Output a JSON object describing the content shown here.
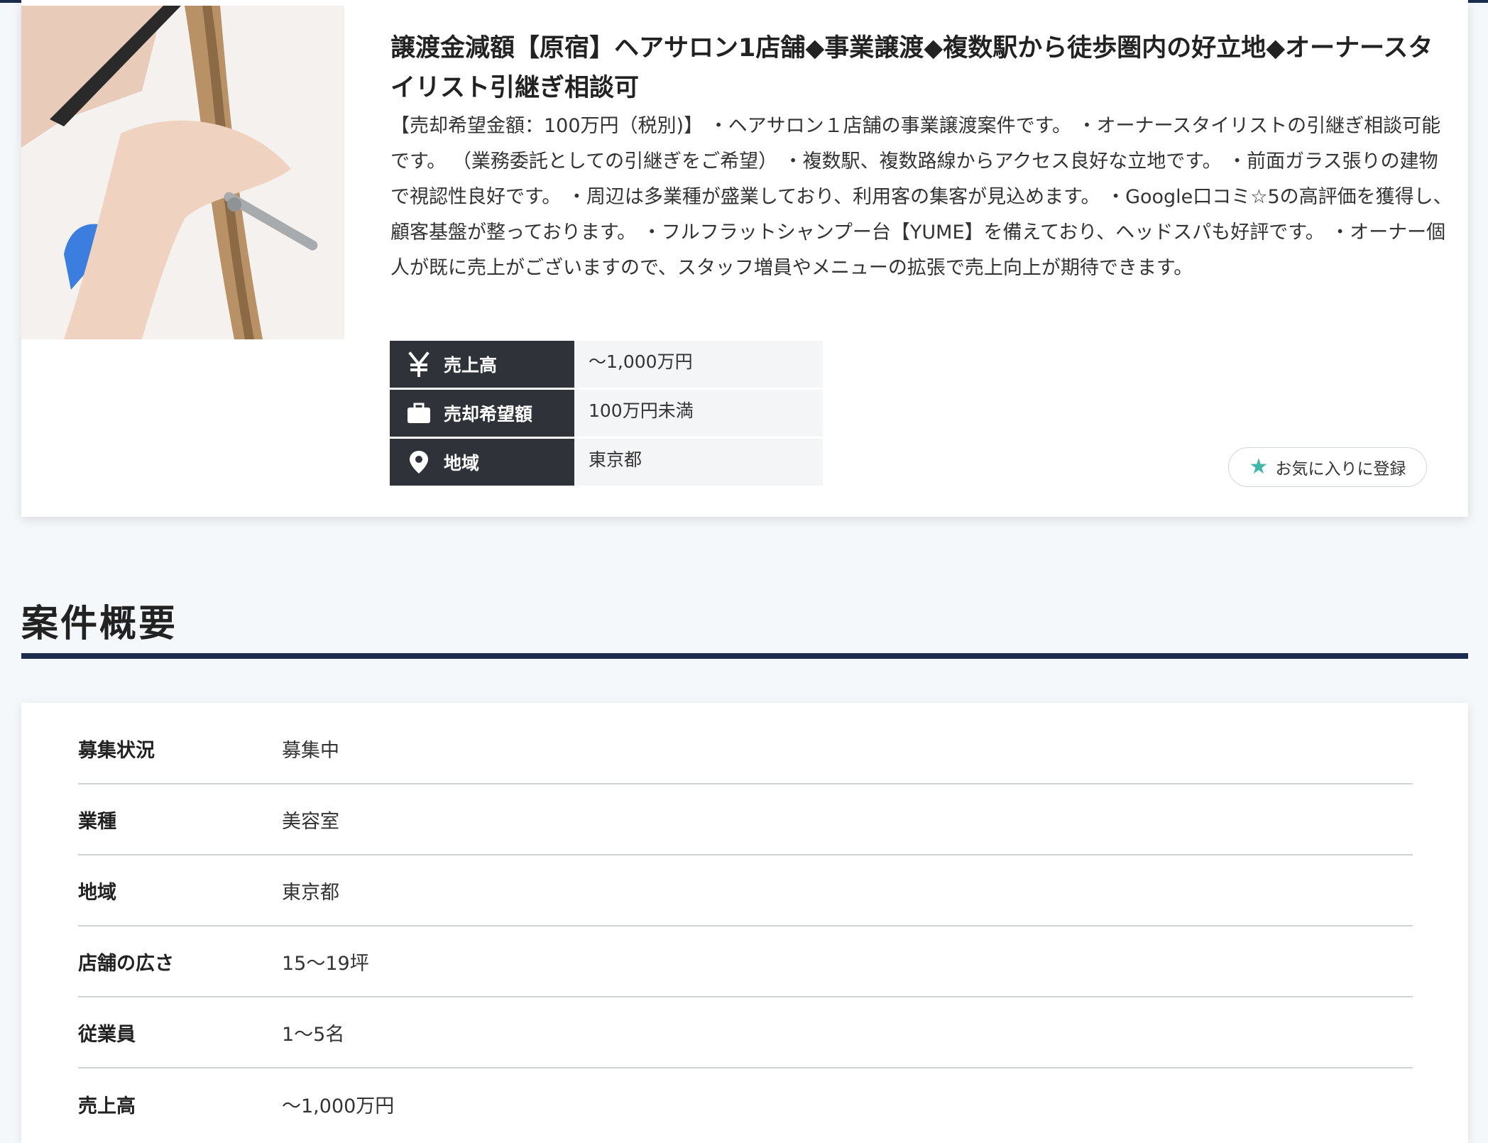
{
  "listing": {
    "title": "譲渡金減額【原宿】ヘアサロン1店舗◆事業譲渡◆複数駅から徒歩圏内の好立地◆オーナースタイリスト引継ぎ相談可",
    "description": "【売却希望金額：100万円（税別)】 ・ヘアサロン１店舗の事業譲渡案件です。 ・オーナースタイリストの引継ぎ相談可能です。 （業務委託としての引継ぎをご希望） ・複数駅、複数路線からアクセス良好な立地です。 ・前面ガラス張りの建物で視認性良好です。 ・周辺は多業種が盛業しており、利用客の集客が見込めます。 ・Google口コミ☆5の高評価を獲得し、顧客基盤が整っております。 ・フルフラットシャンプー台【YUME】を備えており、ヘッドスパも好評です。 ・オーナー個人が既に売上がございますので、スタッフ増員やメニューの拡張で売上向上が期待できます。",
    "specs": [
      {
        "icon": "yen-icon",
        "label": "売上高",
        "value": "〜1,000万円"
      },
      {
        "icon": "briefcase-icon",
        "label": "売却希望額",
        "value": "100万円未満"
      },
      {
        "icon": "map-pin-icon",
        "label": "地域",
        "value": "東京都"
      }
    ],
    "favorite_label": "お気に入りに登録"
  },
  "summary": {
    "title": "案件概要",
    "rows": [
      {
        "label": "募集状況",
        "value": "募集中"
      },
      {
        "label": "業種",
        "value": "美容室"
      },
      {
        "label": "地域",
        "value": "東京都"
      },
      {
        "label": "店舗の広さ",
        "value": "15〜19坪"
      },
      {
        "label": "従業員",
        "value": "1〜5名"
      },
      {
        "label": "売上高",
        "value": "〜1,000万円"
      }
    ]
  },
  "colors": {
    "navy": "#1b2c4f",
    "spec_label_bg": "#2f3238",
    "accent_star": "#3fb6a8"
  }
}
